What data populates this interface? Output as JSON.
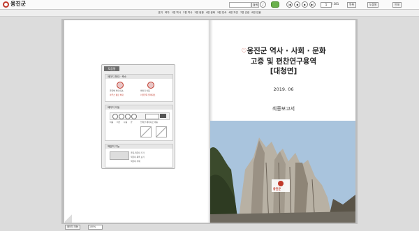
{
  "app": {
    "logo_text": "옹진군"
  },
  "search": {
    "button": "검색"
  },
  "nav": {
    "first": "|◀",
    "prev": "◀",
    "next": "▶",
    "last": "▶|",
    "current_page": "1",
    "total_pages": "/ 381"
  },
  "toolbar": {
    "buttons": [
      "목록",
      "도움말",
      "인쇄"
    ]
  },
  "toc": [
    "표지",
    "목차",
    "1편 역사",
    "2편 역사",
    "3편 현황",
    "4편 문화",
    "5편 민속",
    "6편 자연",
    "7편 관광",
    "8편 인물"
  ],
  "help": {
    "header": "도움말",
    "sections": [
      {
        "title": "페이지 확대 · 축소",
        "items": [
          "클릭해 확대/축소",
          "페이지 이동",
          "마우스 휠로 확대",
          "더블클릭 원래대로"
        ]
      },
      {
        "title": "페이지 이동",
        "items": [
          "처음",
          "이전",
          "다음",
          "끝",
          "입력한 페이지로 이동"
        ]
      },
      {
        "title": "책갈피 기능",
        "items": [
          "클릭-책갈피 추가",
          "책갈피 목록 보기",
          "책갈피 삭제"
        ]
      }
    ]
  },
  "cover": {
    "title_line1": "옹진군 역사 · 사회 · 문화",
    "title_line2": "고증 및 편찬연구용역",
    "title_line3": "[대청면]",
    "date": "2019. 06",
    "report": "최종보고서",
    "photo_logo": "옹진군"
  },
  "bottom": {
    "button": "페이지 이동",
    "zoom": "100%"
  }
}
